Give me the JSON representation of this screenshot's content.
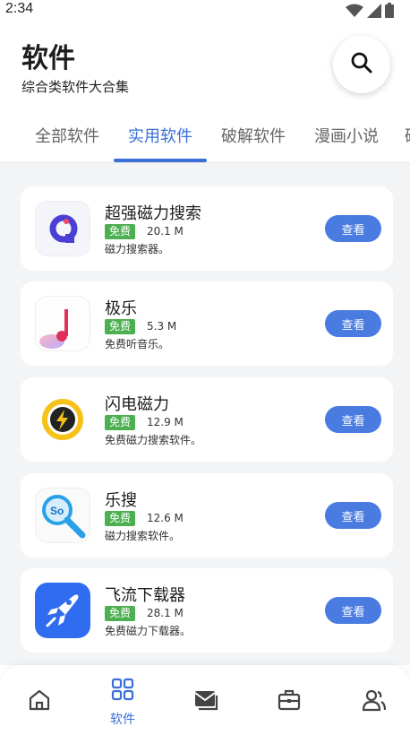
{
  "status": {
    "time": "2:34"
  },
  "header": {
    "title": "软件",
    "subtitle": "综合类软件大合集"
  },
  "tabs": [
    {
      "label": "全部软件",
      "active": false
    },
    {
      "label": "实用软件",
      "active": true
    },
    {
      "label": "破解软件",
      "active": false
    },
    {
      "label": "漫画小说",
      "active": false
    },
    {
      "label": "破",
      "active": false
    }
  ],
  "apps": [
    {
      "name": "超强磁力搜索",
      "badge": "免费",
      "size": "20.1 M",
      "desc": "磁力搜索器。",
      "button": "查看",
      "icon": "q-magnet-icon"
    },
    {
      "name": "极乐",
      "badge": "免费",
      "size": "5.3 M",
      "desc": "免费听音乐。",
      "button": "查看",
      "icon": "music-note-icon"
    },
    {
      "name": "闪电磁力",
      "badge": "免费",
      "size": "12.9 M",
      "desc": "免费磁力搜索软件。",
      "button": "查看",
      "icon": "lightning-icon"
    },
    {
      "name": "乐搜",
      "badge": "免费",
      "size": "12.6 M",
      "desc": "磁力搜索软件。",
      "button": "查看",
      "icon": "so-magnifier-icon"
    },
    {
      "name": "飞流下载器",
      "badge": "免费",
      "size": "28.1 M",
      "desc": "免费磁力下载器。",
      "button": "查看",
      "icon": "rocket-icon"
    }
  ],
  "bottom_nav": {
    "items": [
      {
        "icon": "home-icon",
        "label": ""
      },
      {
        "icon": "grid-icon",
        "label": "软件"
      },
      {
        "icon": "mail-icon",
        "label": ""
      },
      {
        "icon": "toolbox-icon",
        "label": ""
      },
      {
        "icon": "users-icon",
        "label": ""
      }
    ]
  },
  "colors": {
    "accent": "#3a6fd8",
    "button": "#4a7be0",
    "badge": "#4caf50",
    "background": "#f3f4f6"
  }
}
